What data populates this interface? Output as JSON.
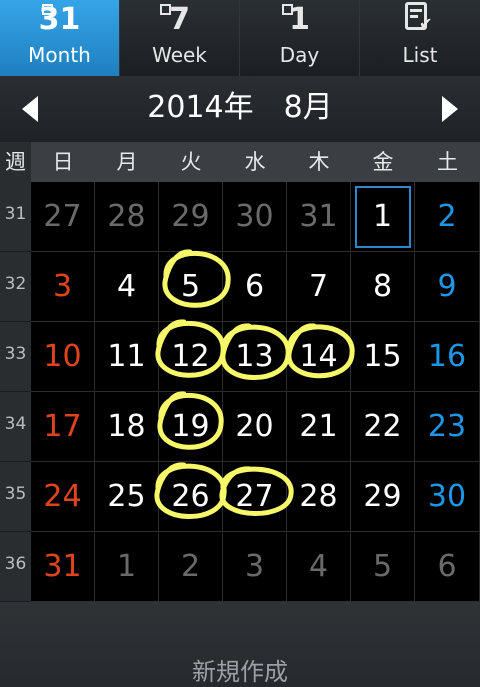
{
  "tabs": [
    {
      "icon_text": "31",
      "label": "Month",
      "active": true
    },
    {
      "icon_text": "7",
      "label": "Week",
      "active": false
    },
    {
      "icon_text": "1",
      "label": "Day",
      "active": false
    },
    {
      "icon_text": "",
      "label": "List",
      "active": false
    }
  ],
  "header": {
    "title": "2014年　8月"
  },
  "weekdays": [
    "週",
    "日",
    "月",
    "火",
    "水",
    "木",
    "金",
    "土"
  ],
  "weeks": [
    {
      "week": "31",
      "days": [
        "27",
        "28",
        "29",
        "30",
        "31",
        "1",
        "2"
      ]
    },
    {
      "week": "32",
      "days": [
        "3",
        "4",
        "5",
        "6",
        "7",
        "8",
        "9"
      ]
    },
    {
      "week": "33",
      "days": [
        "10",
        "11",
        "12",
        "13",
        "14",
        "15",
        "16"
      ]
    },
    {
      "week": "34",
      "days": [
        "17",
        "18",
        "19",
        "20",
        "21",
        "22",
        "23"
      ]
    },
    {
      "week": "35",
      "days": [
        "24",
        "25",
        "26",
        "27",
        "28",
        "29",
        "30"
      ]
    },
    {
      "week": "36",
      "days": [
        "31",
        "1",
        "2",
        "3",
        "4",
        "5",
        "6"
      ]
    }
  ],
  "bottom": {
    "new_label": "新規作成"
  },
  "colors": {
    "accent": "#2f8fd4",
    "sunday": "#e0441e",
    "saturday": "#1e96e6",
    "circle": "#f7f76a"
  }
}
